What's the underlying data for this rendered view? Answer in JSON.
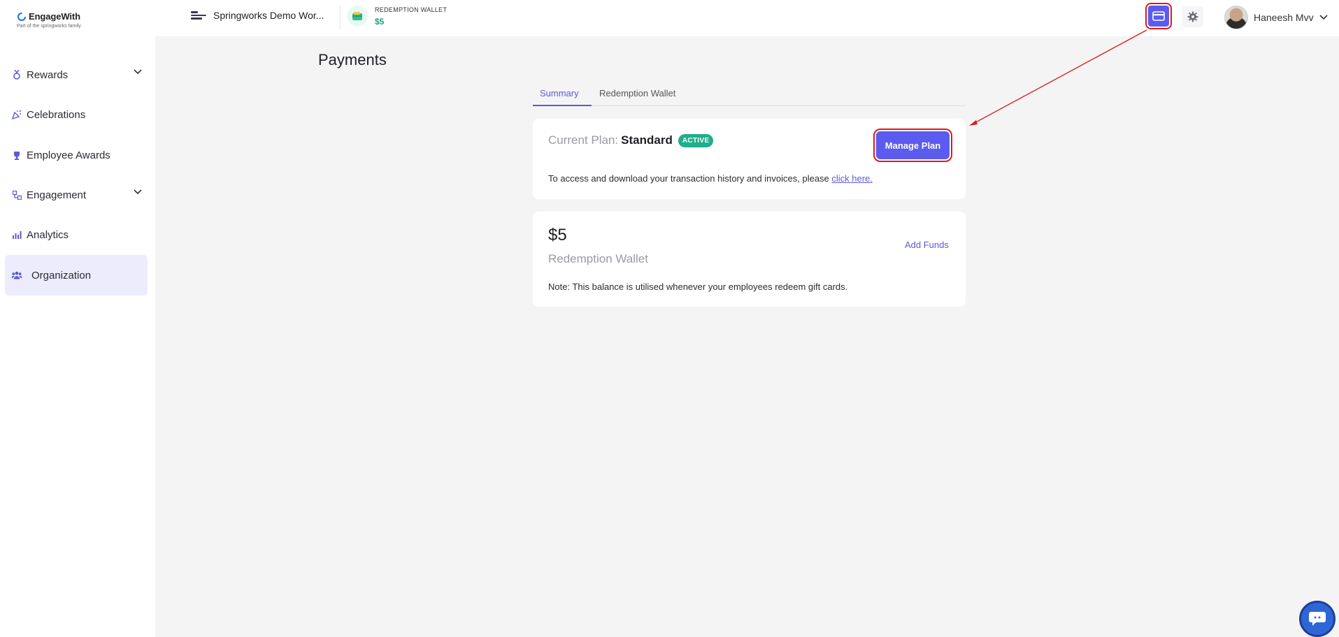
{
  "brand": {
    "name": "EngageWith",
    "tagline": "Part of the springworks family"
  },
  "workspace": {
    "name": "Springworks Demo Wor..."
  },
  "wallet_top": {
    "label": "REDEMPTION WALLET",
    "amount": "$5"
  },
  "user": {
    "name": "Haneesh Mvv"
  },
  "sidebar": {
    "items": [
      {
        "label": "Rewards",
        "icon": "medal-icon",
        "expandable": true
      },
      {
        "label": "Celebrations",
        "icon": "party-icon",
        "expandable": false
      },
      {
        "label": "Employee Awards",
        "icon": "trophy-icon",
        "expandable": false
      },
      {
        "label": "Engagement",
        "icon": "flow-icon",
        "expandable": true
      },
      {
        "label": "Analytics",
        "icon": "bar-chart-icon",
        "expandable": false
      },
      {
        "label": "Organization",
        "icon": "people-icon",
        "expandable": false,
        "active": true
      }
    ]
  },
  "page": {
    "title": "Payments"
  },
  "tabs": [
    {
      "label": "Summary",
      "active": true
    },
    {
      "label": "Redemption Wallet"
    }
  ],
  "plan_card": {
    "label": "Current Plan:",
    "plan": "Standard",
    "badge": "ACTIVE",
    "manage_button": "Manage Plan",
    "access_text": "To access and download your transaction history and invoices, please ",
    "access_link": "click here."
  },
  "wallet_card": {
    "amount": "$5",
    "name": "Redemption Wallet",
    "add_funds": "Add Funds",
    "note": "Note: This balance is utilised whenever your employees redeem gift cards."
  },
  "colors": {
    "accent": "#5b5bf0",
    "active_badge": "#1fae8c",
    "wallet_green": "#14a37f",
    "annotation_red": "#e01818"
  }
}
